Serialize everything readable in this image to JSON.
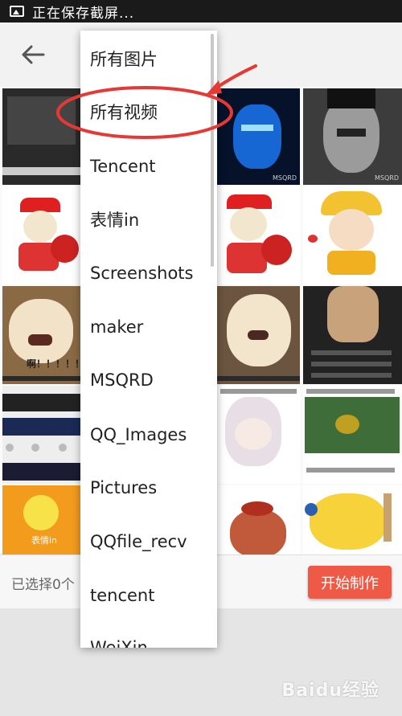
{
  "status_bar": {
    "text": "正在保存截屏..."
  },
  "bottom_bar": {
    "selected_text": "已选择0个",
    "start_button": "开始制作"
  },
  "dropdown": {
    "items": [
      "所有图片",
      "所有视频",
      "Tencent",
      "表情in",
      "Screenshots",
      "maker",
      "MSQRD",
      "QQ_Images",
      "Pictures",
      "QQfile_recv",
      "tencent",
      "WeiXin"
    ],
    "highlighted": "所有视频"
  },
  "grid": {
    "thumb_captions": [
      "啊！！！！！",
      "表情in",
      "MSQRD",
      "MSQRD"
    ]
  },
  "watermark": "Baidu经验",
  "colors": {
    "accent": "#ef5a46",
    "annotation": "#e53935"
  }
}
